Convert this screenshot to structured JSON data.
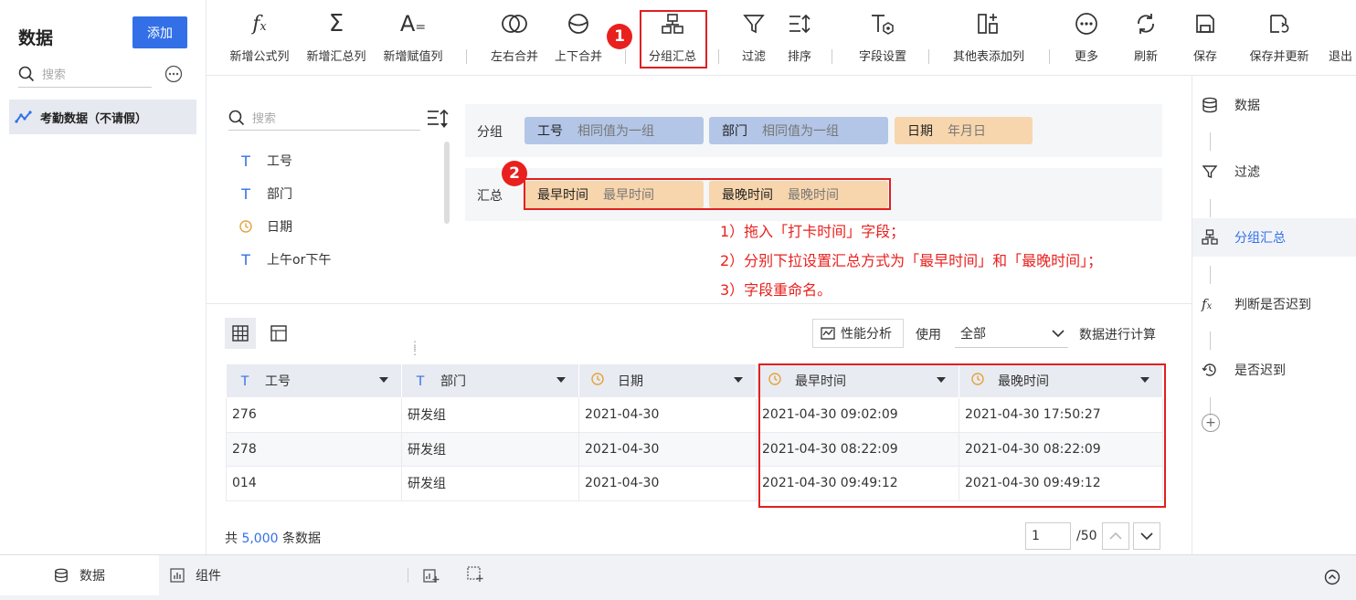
{
  "left": {
    "title": "数据",
    "add_label": "添加",
    "search_placeholder": "搜索",
    "dataset": "考勤数据（不请假）"
  },
  "toolbar": {
    "items": [
      {
        "label": "新增公式列",
        "icon": "formula-icon"
      },
      {
        "label": "新增汇总列",
        "icon": "sigma-icon"
      },
      {
        "label": "新增赋值列",
        "icon": "assign-icon"
      },
      {
        "label": "左右合并",
        "icon": "merge-horizontal-icon"
      },
      {
        "label": "上下合并",
        "icon": "merge-vertical-icon"
      },
      {
        "label": "分组汇总",
        "icon": "group-summary-icon"
      },
      {
        "label": "过滤",
        "icon": "filter-icon"
      },
      {
        "label": "排序",
        "icon": "sort-icon"
      },
      {
        "label": "字段设置",
        "icon": "field-settings-icon"
      },
      {
        "label": "其他表添加列",
        "icon": "add-column-icon"
      },
      {
        "label": "更多",
        "icon": "more-icon"
      },
      {
        "label": "刷新",
        "icon": "refresh-icon"
      },
      {
        "label": "保存",
        "icon": "save-icon"
      },
      {
        "label": "保存并更新",
        "icon": "save-update-icon"
      },
      {
        "label": "退出",
        "icon": "exit-icon"
      }
    ],
    "badge1": "1",
    "badge2": "2"
  },
  "fields": {
    "search_placeholder": "搜索",
    "list": [
      {
        "name": "工号",
        "type": "text"
      },
      {
        "name": "部门",
        "type": "text"
      },
      {
        "name": "日期",
        "type": "date"
      },
      {
        "name": "上午or下午",
        "type": "text"
      }
    ]
  },
  "group": {
    "label": "分组",
    "chips": [
      {
        "name": "工号",
        "mode": "相同值为一组"
      },
      {
        "name": "部门",
        "mode": "相同值为一组"
      },
      {
        "name": "日期",
        "mode": "年月日"
      }
    ]
  },
  "summary": {
    "label": "汇总",
    "chips": [
      {
        "name": "最早时间",
        "mode": "最早时间"
      },
      {
        "name": "最晚时间",
        "mode": "最晚时间"
      }
    ]
  },
  "notes": [
    "1）拖入「打卡时间」字段；",
    "2）分别下拉设置汇总方式为「最早时间」和「最晚时间」；",
    "3）字段重命名。"
  ],
  "table_controls": {
    "perf_label": "性能分析",
    "use_label": "使用",
    "select_value": "全部",
    "calc_label": "数据进行计算"
  },
  "table": {
    "columns": [
      {
        "name": "工号",
        "type": "text"
      },
      {
        "name": "部门",
        "type": "text"
      },
      {
        "name": "日期",
        "type": "date"
      },
      {
        "name": "最早时间",
        "type": "date"
      },
      {
        "name": "最晚时间",
        "type": "date"
      }
    ],
    "rows": [
      [
        "276",
        "研发组",
        "2021-04-30",
        "2021-04-30 09:02:09",
        "2021-04-30 17:50:27"
      ],
      [
        "278",
        "研发组",
        "2021-04-30",
        "2021-04-30 08:22:09",
        "2021-04-30 08:22:09"
      ],
      [
        "014",
        "研发组",
        "2021-04-30",
        "2021-04-30 09:49:12",
        "2021-04-30 09:49:12"
      ]
    ]
  },
  "footer": {
    "total_prefix": "共",
    "total_count": "5,000",
    "total_suffix": "条数据",
    "page": "1",
    "page_total": "/50"
  },
  "right_steps": [
    {
      "label": "数据",
      "icon": "database-icon"
    },
    {
      "label": "过滤",
      "icon": "filter-icon"
    },
    {
      "label": "分组汇总",
      "icon": "group-summary-icon"
    },
    {
      "label": "判断是否迟到",
      "icon": "formula-icon"
    },
    {
      "label": "是否迟到",
      "icon": "history-icon"
    }
  ],
  "bottom": {
    "tab_data": "数据",
    "tab_component": "组件"
  },
  "colors": {
    "accent": "#3370e8",
    "highlight": "#e02020",
    "chip_blue": "#b3c6e7",
    "chip_orange": "#f8d6ad"
  }
}
